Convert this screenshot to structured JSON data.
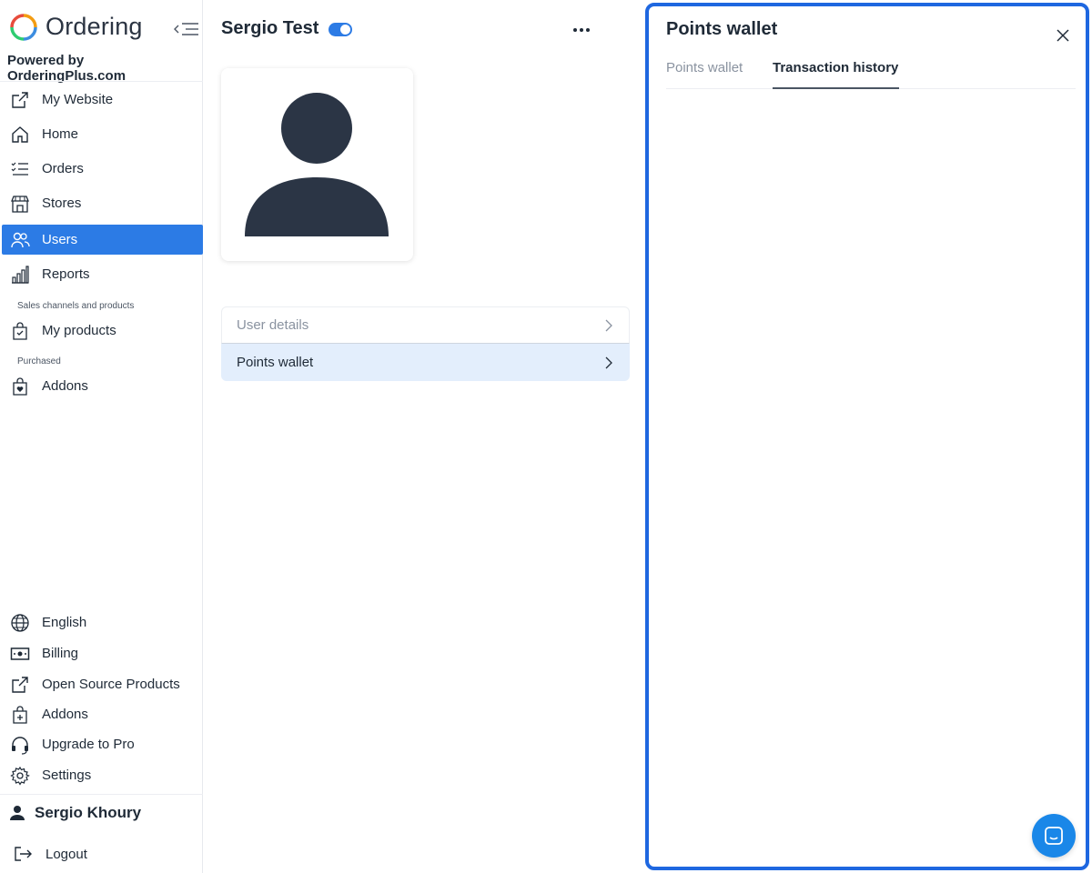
{
  "brand": {
    "name": "Ordering",
    "powered_by": "Powered by OrderingPlus.com"
  },
  "sidebar": {
    "items": [
      {
        "label": "My Website",
        "icon": "external-link-icon"
      },
      {
        "label": "Home",
        "icon": "home-icon"
      },
      {
        "label": "Orders",
        "icon": "list-icon"
      },
      {
        "label": "Stores",
        "icon": "store-icon"
      },
      {
        "label": "Users",
        "icon": "users-icon",
        "active": true
      },
      {
        "label": "Reports",
        "icon": "bar-chart-icon"
      }
    ],
    "section_sales": "Sales channels and products",
    "my_products": "My products",
    "section_purchased": "Purchased",
    "addons_top": "Addons",
    "bottom_items": [
      {
        "label": "English",
        "icon": "globe-icon"
      },
      {
        "label": "Billing",
        "icon": "billing-icon"
      },
      {
        "label": "Open Source Products",
        "icon": "external-link-icon"
      },
      {
        "label": "Addons",
        "icon": "bag-plus-icon"
      },
      {
        "label": "Upgrade to Pro",
        "icon": "headset-icon"
      },
      {
        "label": "Settings",
        "icon": "gear-icon"
      }
    ],
    "user_name": "Sergio Khoury",
    "logout": "Logout"
  },
  "user": {
    "name": "Sergio Test",
    "enabled": true,
    "menu": [
      {
        "label": "User details"
      },
      {
        "label": "Points wallet"
      }
    ]
  },
  "panel": {
    "title": "Points wallet",
    "tabs": [
      {
        "label": "Points wallet"
      },
      {
        "label": "Transaction history"
      }
    ]
  },
  "colors": {
    "accent": "#2c7be5",
    "panel_border": "#1e67e0",
    "chat": "#1a87e8"
  }
}
